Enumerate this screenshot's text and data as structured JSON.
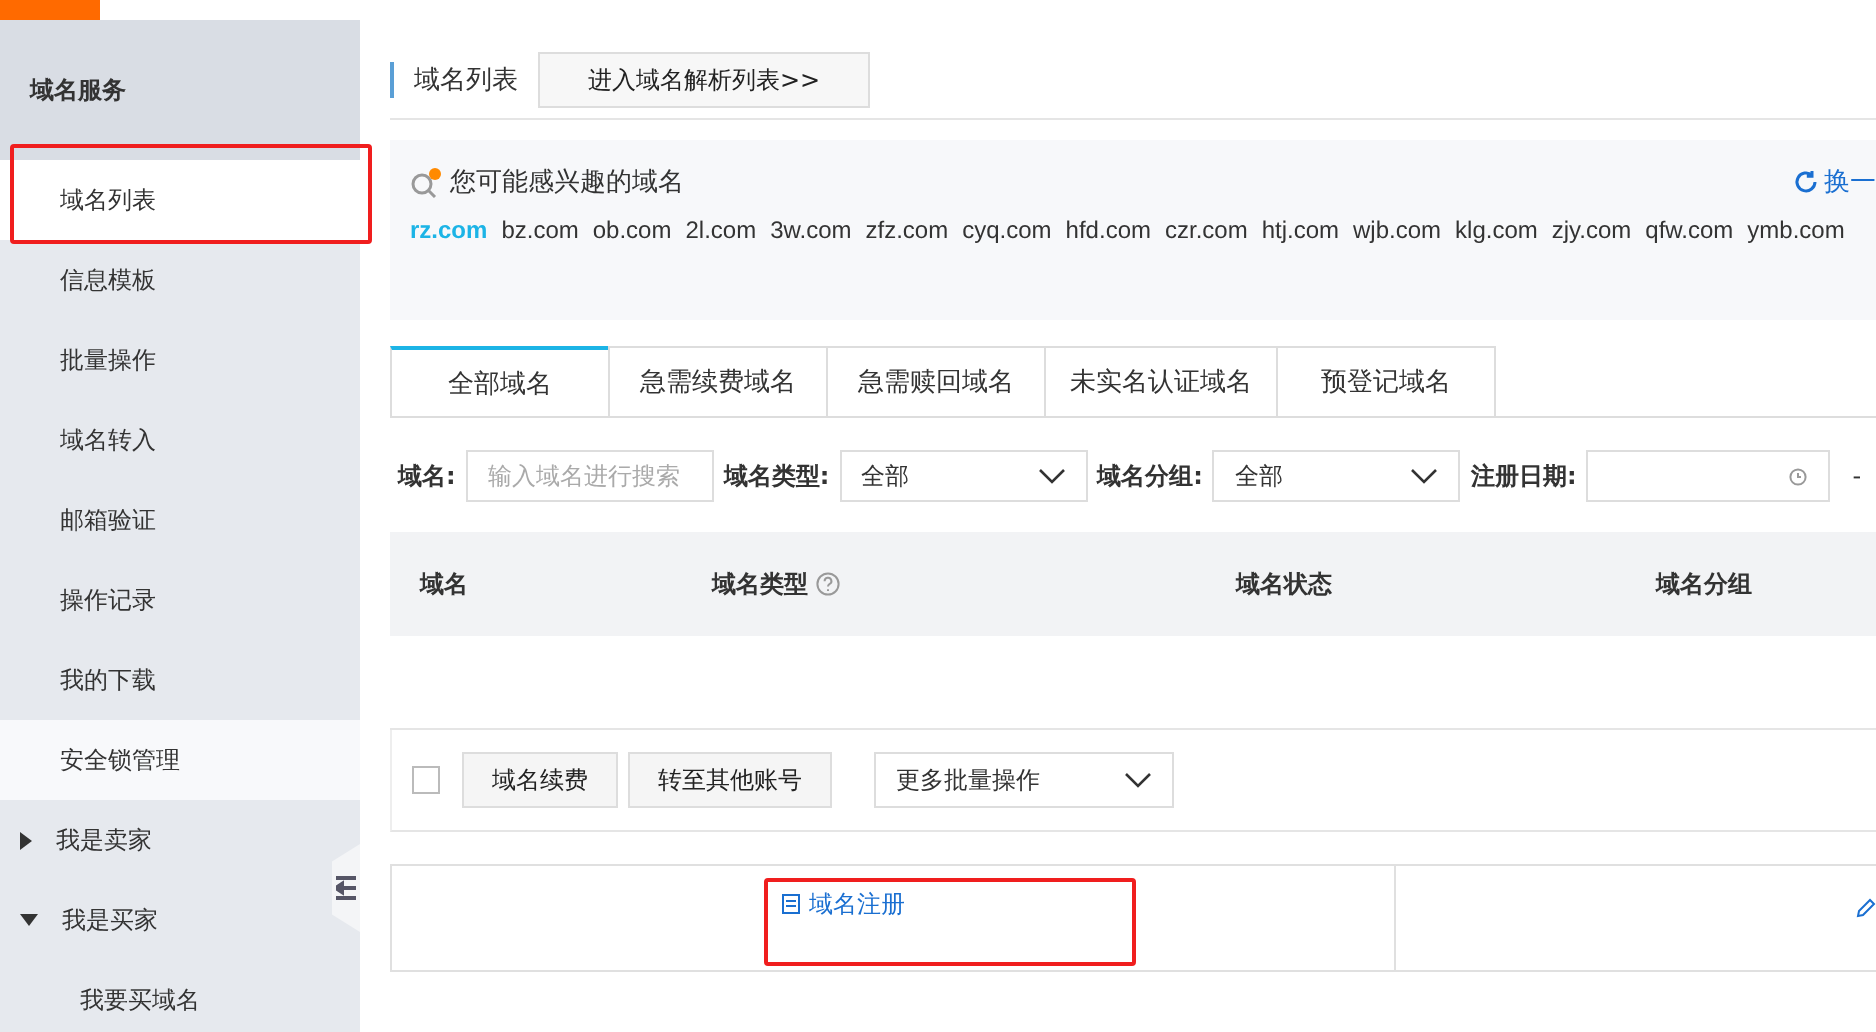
{
  "sidebar": {
    "title": "域名服务",
    "items": [
      {
        "label": "域名列表",
        "selected": true,
        "highlighted": true,
        "hovered": false
      },
      {
        "label": "信息模板",
        "selected": false,
        "highlighted": false,
        "hovered": false
      },
      {
        "label": "批量操作",
        "selected": false,
        "highlighted": false,
        "hovered": false
      },
      {
        "label": "域名转入",
        "selected": false,
        "highlighted": false,
        "hovered": false
      },
      {
        "label": "邮箱验证",
        "selected": false,
        "highlighted": false,
        "hovered": false
      },
      {
        "label": "操作记录",
        "selected": false,
        "highlighted": false,
        "hovered": false
      },
      {
        "label": "我的下载",
        "selected": false,
        "highlighted": false,
        "hovered": false
      },
      {
        "label": "安全锁管理",
        "selected": false,
        "highlighted": false,
        "hovered": true
      }
    ],
    "groups": [
      {
        "label": "我是卖家",
        "expanded": false
      },
      {
        "label": "我是买家",
        "expanded": true,
        "children": [
          {
            "label": "我要买域名"
          }
        ]
      }
    ]
  },
  "header": {
    "title": "域名列表",
    "button": "进入域名解析列表>>"
  },
  "suggest": {
    "title": "您可能感兴趣的域名",
    "refresh": "换一",
    "domains": [
      {
        "label": "rz.com",
        "selected": true
      },
      {
        "label": "bz.com",
        "selected": false
      },
      {
        "label": "ob.com",
        "selected": false
      },
      {
        "label": "2l.com",
        "selected": false
      },
      {
        "label": "3w.com",
        "selected": false
      },
      {
        "label": "zfz.com",
        "selected": false
      },
      {
        "label": "cyq.com",
        "selected": false
      },
      {
        "label": "hfd.com",
        "selected": false
      },
      {
        "label": "czr.com",
        "selected": false
      },
      {
        "label": "htj.com",
        "selected": false
      },
      {
        "label": "wjb.com",
        "selected": false
      },
      {
        "label": "klg.com",
        "selected": false
      },
      {
        "label": "zjy.com",
        "selected": false
      },
      {
        "label": "qfw.com",
        "selected": false
      },
      {
        "label": "ymb.com",
        "selected": false
      }
    ]
  },
  "tabs": [
    {
      "label": "全部域名",
      "selected": true
    },
    {
      "label": "急需续费域名",
      "selected": false
    },
    {
      "label": "急需赎回域名",
      "selected": false
    },
    {
      "label": "未实名认证域名",
      "selected": false
    },
    {
      "label": "预登记域名",
      "selected": false
    }
  ],
  "filters": {
    "name_label": "域名:",
    "name_placeholder": "输入域名进行搜索",
    "type_label": "域名类型:",
    "type_value": "全部",
    "group_label": "域名分组:",
    "group_value": "全部",
    "date_label": "注册日期:",
    "date_sep": "-"
  },
  "table": {
    "columns": [
      {
        "label": "域名",
        "help": false
      },
      {
        "label": "域名类型",
        "help": true
      },
      {
        "label": "域名状态",
        "help": false
      },
      {
        "label": "域名分组",
        "help": false
      }
    ]
  },
  "actions": {
    "checked": false,
    "buttons": [
      "域名续费",
      "转至其他账号"
    ],
    "more": "更多批量操作"
  },
  "cards": [
    {
      "label": "域名注册",
      "highlighted": true
    }
  ]
}
